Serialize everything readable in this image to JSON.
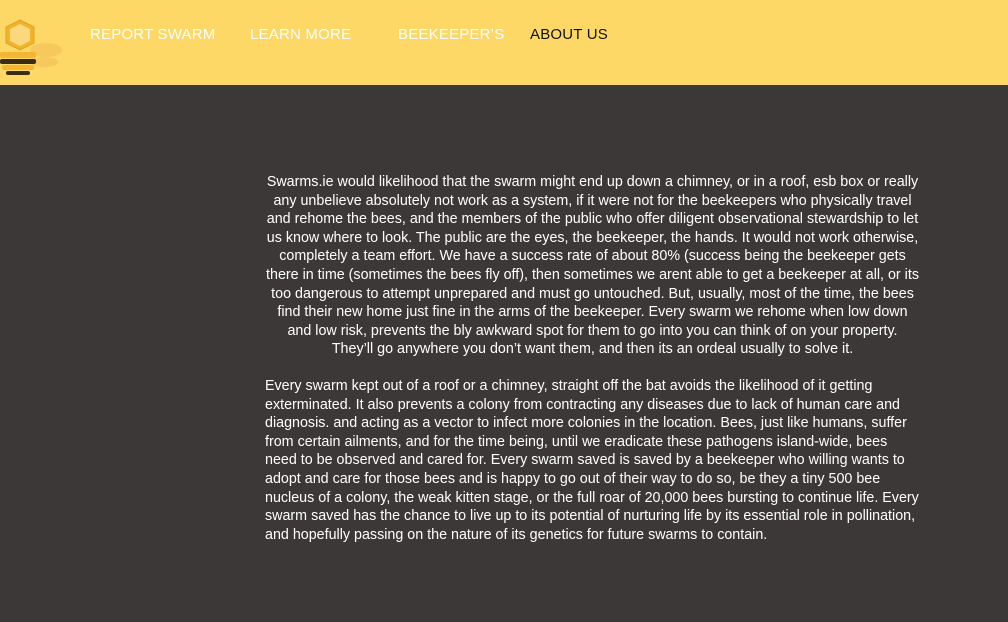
{
  "colors": {
    "header_bg": "#fed866",
    "page_bg": "#3c3838",
    "nav_text": "#ffffff",
    "nav_active_text": "#111111",
    "body_text": "#ffffff"
  },
  "logo": {
    "icon": "bee-hexagon-logo-icon"
  },
  "nav": {
    "report_swarm": "REPORT SWARM",
    "learn_more": "LEARN MORE",
    "beekeepers": "BEEKEEPER’S",
    "about_us": "ABOUT US"
  },
  "content": {
    "paragraph_1": "Swarms.ie would likelihood that the swarm might end up down a chimney, or in a roof, esb box or really any unbelieve absolutely not work as a system, if it were not for the beekeepers who physically travel and rehome the bees, and the members of the public who offer diligent observational stewardship to let us know where to look. The public are the eyes, the beekeeper, the hands. It would not work otherwise, completely a team effort. We have a success rate of about 80% (success being the beekeeper gets there in time (sometimes the bees fly off), then sometimes we arent able to get a beekeeper at all, or its too dangerous to attempt unprepared and must go untouched. But, usually, most of the time, the bees find their new home just fine in the arms of the beekeeper. Every swarm we rehome when low down and low risk, prevents the bly awkward spot for them to go into you can think of on your property. They’ll go anywhere you don’t want them, and then its an ordeal usually to solve it.",
    "paragraph_2": "Every swarm kept out of a roof or a chimney, straight off the bat avoids the likelihood of it getting exterminated. It also prevents a colony from contracting any diseases due to lack of human care and diagnosis. and acting as a vector to infect more colonies in the location. Bees, just like humans, suffer from certain ailments, and for the time being, until we eradicate these pathogens island-wide, bees need to be observed and cared for. Every swarm saved is saved by a beekeeper who willing wants to adopt and care for those bees and is happy to go out of their way to do so, be they a tiny 500 bee nucleus of a colony, the weak kitten stage, or the full roar of 20,000 bees bursting to continue life. Every swarm saved has the chance to live up to its potential of nurturing life by its essential role in pollination, and hopefully passing on the nature of its genetics for future swarms to contain."
  }
}
